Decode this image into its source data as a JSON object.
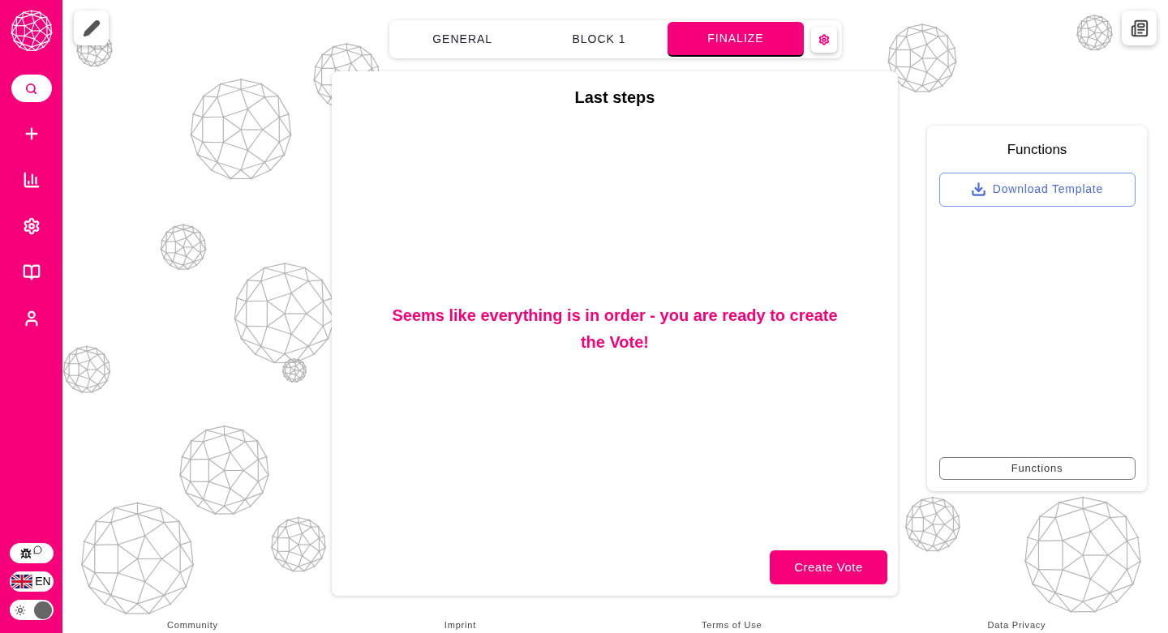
{
  "sidebar": {
    "nav": [
      {
        "kind": "search",
        "selected": true
      },
      {
        "kind": "add",
        "selected": false
      },
      {
        "kind": "stats",
        "selected": false
      },
      {
        "kind": "settings",
        "selected": false
      },
      {
        "kind": "guide",
        "selected": false
      },
      {
        "kind": "profile",
        "selected": false
      }
    ],
    "language": "EN",
    "theme_toggle": {
      "on": true
    }
  },
  "tabs": [
    {
      "label": "GENERAL",
      "selected": false
    },
    {
      "label": "BLOCK 1",
      "selected": false
    },
    {
      "label": "FINALIZE",
      "selected": true
    }
  ],
  "main_card": {
    "title": "Last steps",
    "message": "Seems like everything is in order - you are ready to create the Vote!",
    "button": "Create Vote"
  },
  "functions_panel": {
    "title": "Functions",
    "buttons": [
      "Download Template"
    ],
    "footer_button": "Functions"
  },
  "footer": [
    "Community",
    "Imprint",
    "Terms of Use",
    "Data Privacy"
  ]
}
